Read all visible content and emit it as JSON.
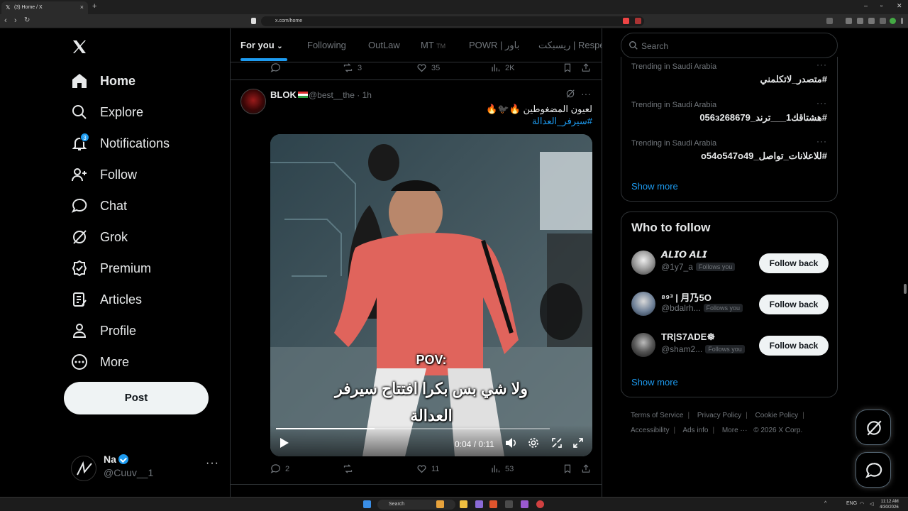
{
  "browser": {
    "tab_title": "(3) Home / X",
    "url": "x.com/home",
    "search_placeholder": "Search"
  },
  "nav": {
    "items": [
      {
        "label": "Home",
        "icon": "home-icon"
      },
      {
        "label": "Explore",
        "icon": "search-icon"
      },
      {
        "label": "Notifications",
        "icon": "bell-icon",
        "badge": "3"
      },
      {
        "label": "Follow",
        "icon": "person-plus-icon"
      },
      {
        "label": "Chat",
        "icon": "chat-bubble-icon"
      },
      {
        "label": "Grok",
        "icon": "grok-icon"
      },
      {
        "label": "Premium",
        "icon": "verified-badge-icon"
      },
      {
        "label": "Articles",
        "icon": "article-icon"
      },
      {
        "label": "Profile",
        "icon": "person-icon"
      },
      {
        "label": "More",
        "icon": "more-circle-icon"
      }
    ],
    "post_label": "Post",
    "account": {
      "name": "Na",
      "handle": "@Cuuv__1"
    }
  },
  "feed": {
    "tabs": [
      "For you",
      "Following",
      "OutLaw",
      "MT",
      "POWR | باور",
      "ريسبكت | Respe"
    ],
    "tab_mt_suffix": "TM",
    "prev_tweet_stats": {
      "replies": "",
      "reposts": "3",
      "likes": "35",
      "views": "2K"
    },
    "tweet": {
      "name": "BLOK",
      "handle": "@best__the",
      "time": "· 1h",
      "text": "لعيون المضغوطين 🔥🐦‍⬛🔥",
      "hashtag": "#سيرفر_العدالة",
      "video": {
        "caption_pov": "POV:",
        "caption_line1": "ولا شي بس بكرا افتتاح سيرفر",
        "caption_line2": "العدالة",
        "time": "0:04 / 0:11",
        "progress": 0.36
      },
      "stats": {
        "replies": "2",
        "reposts": "",
        "likes": "11",
        "views": "53"
      }
    }
  },
  "sidebar": {
    "trends": [
      {
        "meta": "Trending in Saudi Arabia",
        "title": "#متصدر_لاتكلمني"
      },
      {
        "meta": "Trending in Saudi Arabia",
        "title": "#هشتاقك1___ترند_056з268679"
      },
      {
        "meta": "Trending in Saudi Arabia",
        "title": "#للاعلانات_تواصل_o54o547o49"
      }
    ],
    "show_more": "Show more",
    "who_to_follow": {
      "title": "Who to follow",
      "users": [
        {
          "name": "𝘼𝙇𝙄𝙊 𝘼𝙇𝙄",
          "handle": "@1y7_a",
          "follows_you": "Follows you",
          "button": "Follow back"
        },
        {
          "name": "⁸⁹³ | 月乃5O",
          "handle": "@bdalrh...",
          "follows_you": "Follows you",
          "button": "Follow back"
        },
        {
          "name": "TR|S7ADE☸",
          "handle": "@sham2...",
          "follows_you": "Follows you",
          "button": "Follow back"
        }
      ],
      "show_more": "Show more"
    },
    "footer": [
      "Terms of Service",
      "Privacy Policy",
      "Cookie Policy",
      "Accessibility",
      "Ads info",
      "More ···",
      "© 2026 X Corp."
    ]
  },
  "taskbar": {
    "search_label": "Search",
    "lang": "ENG",
    "time": "11:12 AM",
    "date": "4/30/2026"
  },
  "colors": {
    "accent": "#1d9bf0",
    "background": "#000000",
    "border": "#2f3336",
    "muted": "#71767b"
  }
}
